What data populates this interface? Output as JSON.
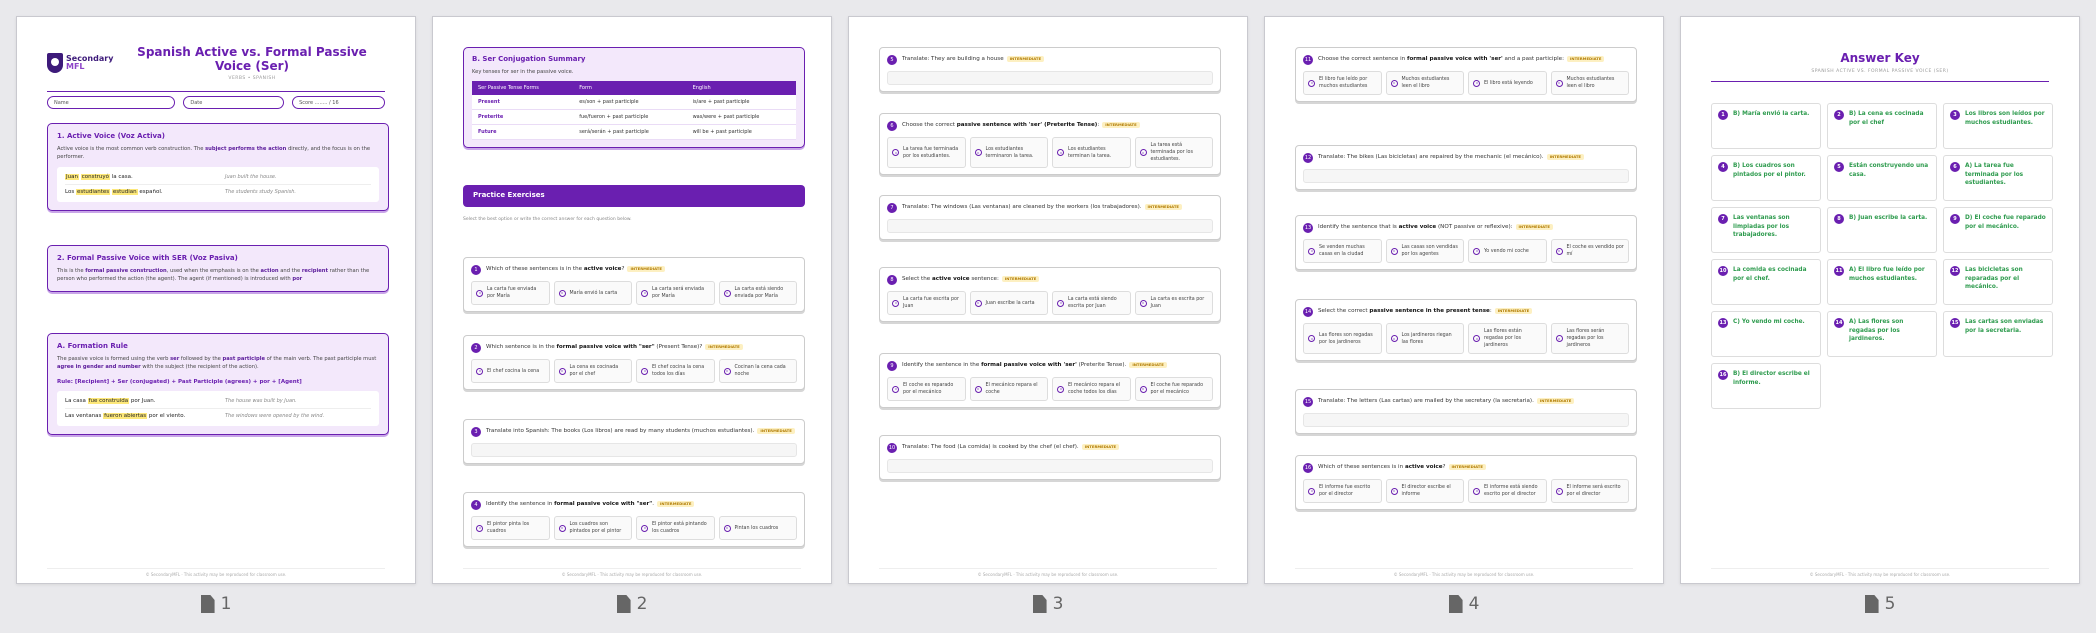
{
  "page_numbers": [
    "1",
    "2",
    "3",
    "4",
    "5"
  ],
  "footer": "© SecondaryMFL · This activity may be reproduced for classroom use.",
  "page1": {
    "logo": {
      "line1": "Secondary",
      "line2": "MFL"
    },
    "title": "Spanish Active vs. Formal Passive Voice (Ser)",
    "subtitle": "VERBS • SPANISH",
    "fields": {
      "name": "Name",
      "date": "Date",
      "score": "Score ........ / 16"
    },
    "sec1": {
      "title": "1. Active Voice (Voz Activa)",
      "text_a": "Active voice is the most common verb construction. The ",
      "text_b": "subject performs the action",
      "text_c": " directly, and the focus is on the performer.",
      "ex1": {
        "w1": "Juan",
        "w2": "construyó",
        "rest": " la casa.",
        "en": "Juan built the house."
      },
      "ex2": {
        "pre": "Los ",
        "w1": "estudiantes",
        "w2": "estudian",
        "rest": " español.",
        "en": "The students study Spanish."
      }
    },
    "sec2": {
      "title": "2. Formal Passive Voice with SER (Voz Pasiva)",
      "t1": "This is the ",
      "b1": "formal passive construction",
      "t2": ", used when the emphasis is on the ",
      "b2": "action",
      "t3": " and the ",
      "b3": "recipient",
      "t4": " rather than the person who performed the action (the agent). The agent (if mentioned) is introduced with ",
      "b4": "por"
    },
    "sec3": {
      "title": "A. Formation Rule",
      "t1": "The passive voice is formed using the verb ",
      "b1": "ser",
      "t2": " followed by the ",
      "b2": "past participle",
      "t3": " of the main verb. The past participle must ",
      "b3": "agree in gender and number",
      "t4": " with the subject (the recipient of the action).",
      "rule": "Rule: [Recipient] + Ser (conjugated) + Past Participle (agrees) + por + [Agent]",
      "ex1": {
        "pre": "La casa ",
        "hl": "fue construida",
        "rest": " por Juan.",
        "en": "The house was built by Juan."
      },
      "ex2": {
        "pre": "Las ventanas ",
        "hl": "fueron abiertas",
        "rest": " por el viento.",
        "en": "The windows were opened by the wind."
      }
    }
  },
  "page2": {
    "conj_title": "B. Ser Conjugation Summary",
    "conj_sub": "Key tenses for ser in the passive voice.",
    "conj_headers": [
      "Ser Passive Tense Forms",
      "Form",
      "English"
    ],
    "conj_rows": [
      [
        "Present",
        "es/son + past participle",
        "is/are + past participle"
      ],
      [
        "Preterite",
        "fue/fueron + past participle",
        "was/were + past participle"
      ],
      [
        "Future",
        "será/serán + past participle",
        "will be + past participle"
      ]
    ],
    "practice_title": "Practice Exercises",
    "instructions": "Select the best option or write the correct answer for each question below."
  },
  "tag": "INTERMEDIATE",
  "questions": [
    {
      "n": "1",
      "pre": "Which of these sentences is in the ",
      "b": "active voice",
      "post": "?",
      "opts": [
        "La carta fue enviada por María",
        "María envió la carta",
        "La carta será enviada por María",
        "La carta está siendo enviada por María"
      ]
    },
    {
      "n": "2",
      "pre": "Which sentence is in the ",
      "b": "formal passive voice with \"ser\"",
      "post": " (Present Tense)?",
      "opts": [
        "El chef cocina la cena",
        "La cena es cocinada por el chef",
        "El chef cocina la cena todos los días",
        "Cocinan la cena cada noche"
      ]
    },
    {
      "n": "3",
      "pre": "Translate into Spanish: The books (Los libros) are read by many students (muchos estudiantes).",
      "b": "",
      "post": "",
      "opts": []
    },
    {
      "n": "4",
      "pre": "Identify the sentence in ",
      "b": "formal passive voice with \"ser\"",
      "post": ".",
      "opts": [
        "El pintor pinta los cuadros",
        "Los cuadros son pintados por el pintor",
        "El pintor está pintando los cuadros",
        "Pintan los cuadros"
      ]
    },
    {
      "n": "5",
      "pre": "Translate: They are building a house",
      "b": "",
      "post": "",
      "opts": []
    },
    {
      "n": "6",
      "pre": "Choose the correct ",
      "b": "passive sentence with 'ser' (Preterite Tense)",
      "post": ":",
      "opts": [
        "La tarea fue terminada por los estudiantes.",
        "Los estudiantes terminaron la tarea.",
        "Los estudiantes terminan la tarea.",
        "La tarea está terminada por los estudiantes."
      ]
    },
    {
      "n": "7",
      "pre": "Translate: The windows (Las ventanas) are cleaned by the workers (los trabajadores).",
      "b": "",
      "post": "",
      "opts": []
    },
    {
      "n": "8",
      "pre": "Select the ",
      "b": "active voice",
      "post": " sentence:",
      "opts": [
        "La carta fue escrita por Juan",
        "Juan escribe la carta",
        "La carta está siendo escrita por Juan",
        "La carta es escrita por Juan"
      ]
    },
    {
      "n": "9",
      "pre": "Identify the sentence in the ",
      "b": "formal passive voice with 'ser'",
      "post": " (Preterite Tense).",
      "opts": [
        "El coche es reparado por el mecánico",
        "El mecánico repara el coche",
        "El mecánico repara el coche todos los días",
        "El coche fue reparado por el mecánico"
      ]
    },
    {
      "n": "10",
      "pre": "Translate: The food (La comida) is cooked by the chef (el chef).",
      "b": "",
      "post": "",
      "opts": []
    },
    {
      "n": "11",
      "pre": "Choose the correct sentence in ",
      "b": "formal passive voice with 'ser'",
      "post": " and a past participle:",
      "opts": [
        "El libro fue leído por muchos estudiantes",
        "Muchos estudiantes leen el libro",
        "El libro está leyendo",
        "Muchos estudiantes leen el libro"
      ]
    },
    {
      "n": "12",
      "pre": "Translate: The bikes (Las bicicletas) are repaired by the mechanic (el mecánico).",
      "b": "",
      "post": "",
      "opts": []
    },
    {
      "n": "13",
      "pre": "Identify the sentence that is ",
      "b": "active voice",
      "post": " (NOT passive or reflexive):",
      "opts": [
        "Se venden muchas casas en la ciudad",
        "Las casas son vendidas por los agentes",
        "Yo vendo mi coche",
        "El coche es vendido por mí"
      ]
    },
    {
      "n": "14",
      "pre": "Select the correct ",
      "b": "passive sentence in the present tense",
      "post": ":",
      "opts": [
        "Las flores son regadas por los jardineros",
        "Los jardineros riegan las flores",
        "Las flores están regadas por los jardineros",
        "Las flores serán regadas por los jardineros"
      ]
    },
    {
      "n": "15",
      "pre": "Translate: The letters (Las cartas) are mailed by the secretary (la secretaria).",
      "b": "",
      "post": "",
      "opts": []
    },
    {
      "n": "16",
      "pre": "Which of these sentences is in ",
      "b": "active voice",
      "post": "?",
      "opts": [
        "El informe fue escrito por el director",
        "El director escribe el informe",
        "El informe está siendo escrito por el director",
        "El informe será escrito por el director"
      ]
    }
  ],
  "answer_key": {
    "title": "Answer Key",
    "subtitle": "SPANISH ACTIVE VS. FORMAL PASSIVE VOICE (SER)",
    "answers": [
      {
        "n": "1",
        "a": "B)  María envió la carta."
      },
      {
        "n": "2",
        "a": "B)  La cena es cocinada por el chef"
      },
      {
        "n": "3",
        "a": "Los libros son leídos por muchos estudiantes."
      },
      {
        "n": "4",
        "a": "B)  Los cuadros son pintados por el pintor."
      },
      {
        "n": "5",
        "a": "Están construyendo una casa."
      },
      {
        "n": "6",
        "a": "A)  La tarea fue terminada por los estudiantes."
      },
      {
        "n": "7",
        "a": "Las ventanas son limpiadas por los trabajadores."
      },
      {
        "n": "8",
        "a": "B)  Juan escribe la carta."
      },
      {
        "n": "9",
        "a": "D)  El coche fue reparado por el mecánico."
      },
      {
        "n": "10",
        "a": "La comida es cocinada por el chef."
      },
      {
        "n": "11",
        "a": "A)  El libro fue leído por muchos estudiantes."
      },
      {
        "n": "12",
        "a": "Las bicicletas son reparadas por el mecánico."
      },
      {
        "n": "13",
        "a": "C)  Yo vendo mi coche."
      },
      {
        "n": "14",
        "a": "A)  Las flores son regadas por los jardineros."
      },
      {
        "n": "15",
        "a": "Las cartas son enviadas por la secretaria."
      },
      {
        "n": "16",
        "a": "B)  El director escribe el informe."
      }
    ]
  }
}
